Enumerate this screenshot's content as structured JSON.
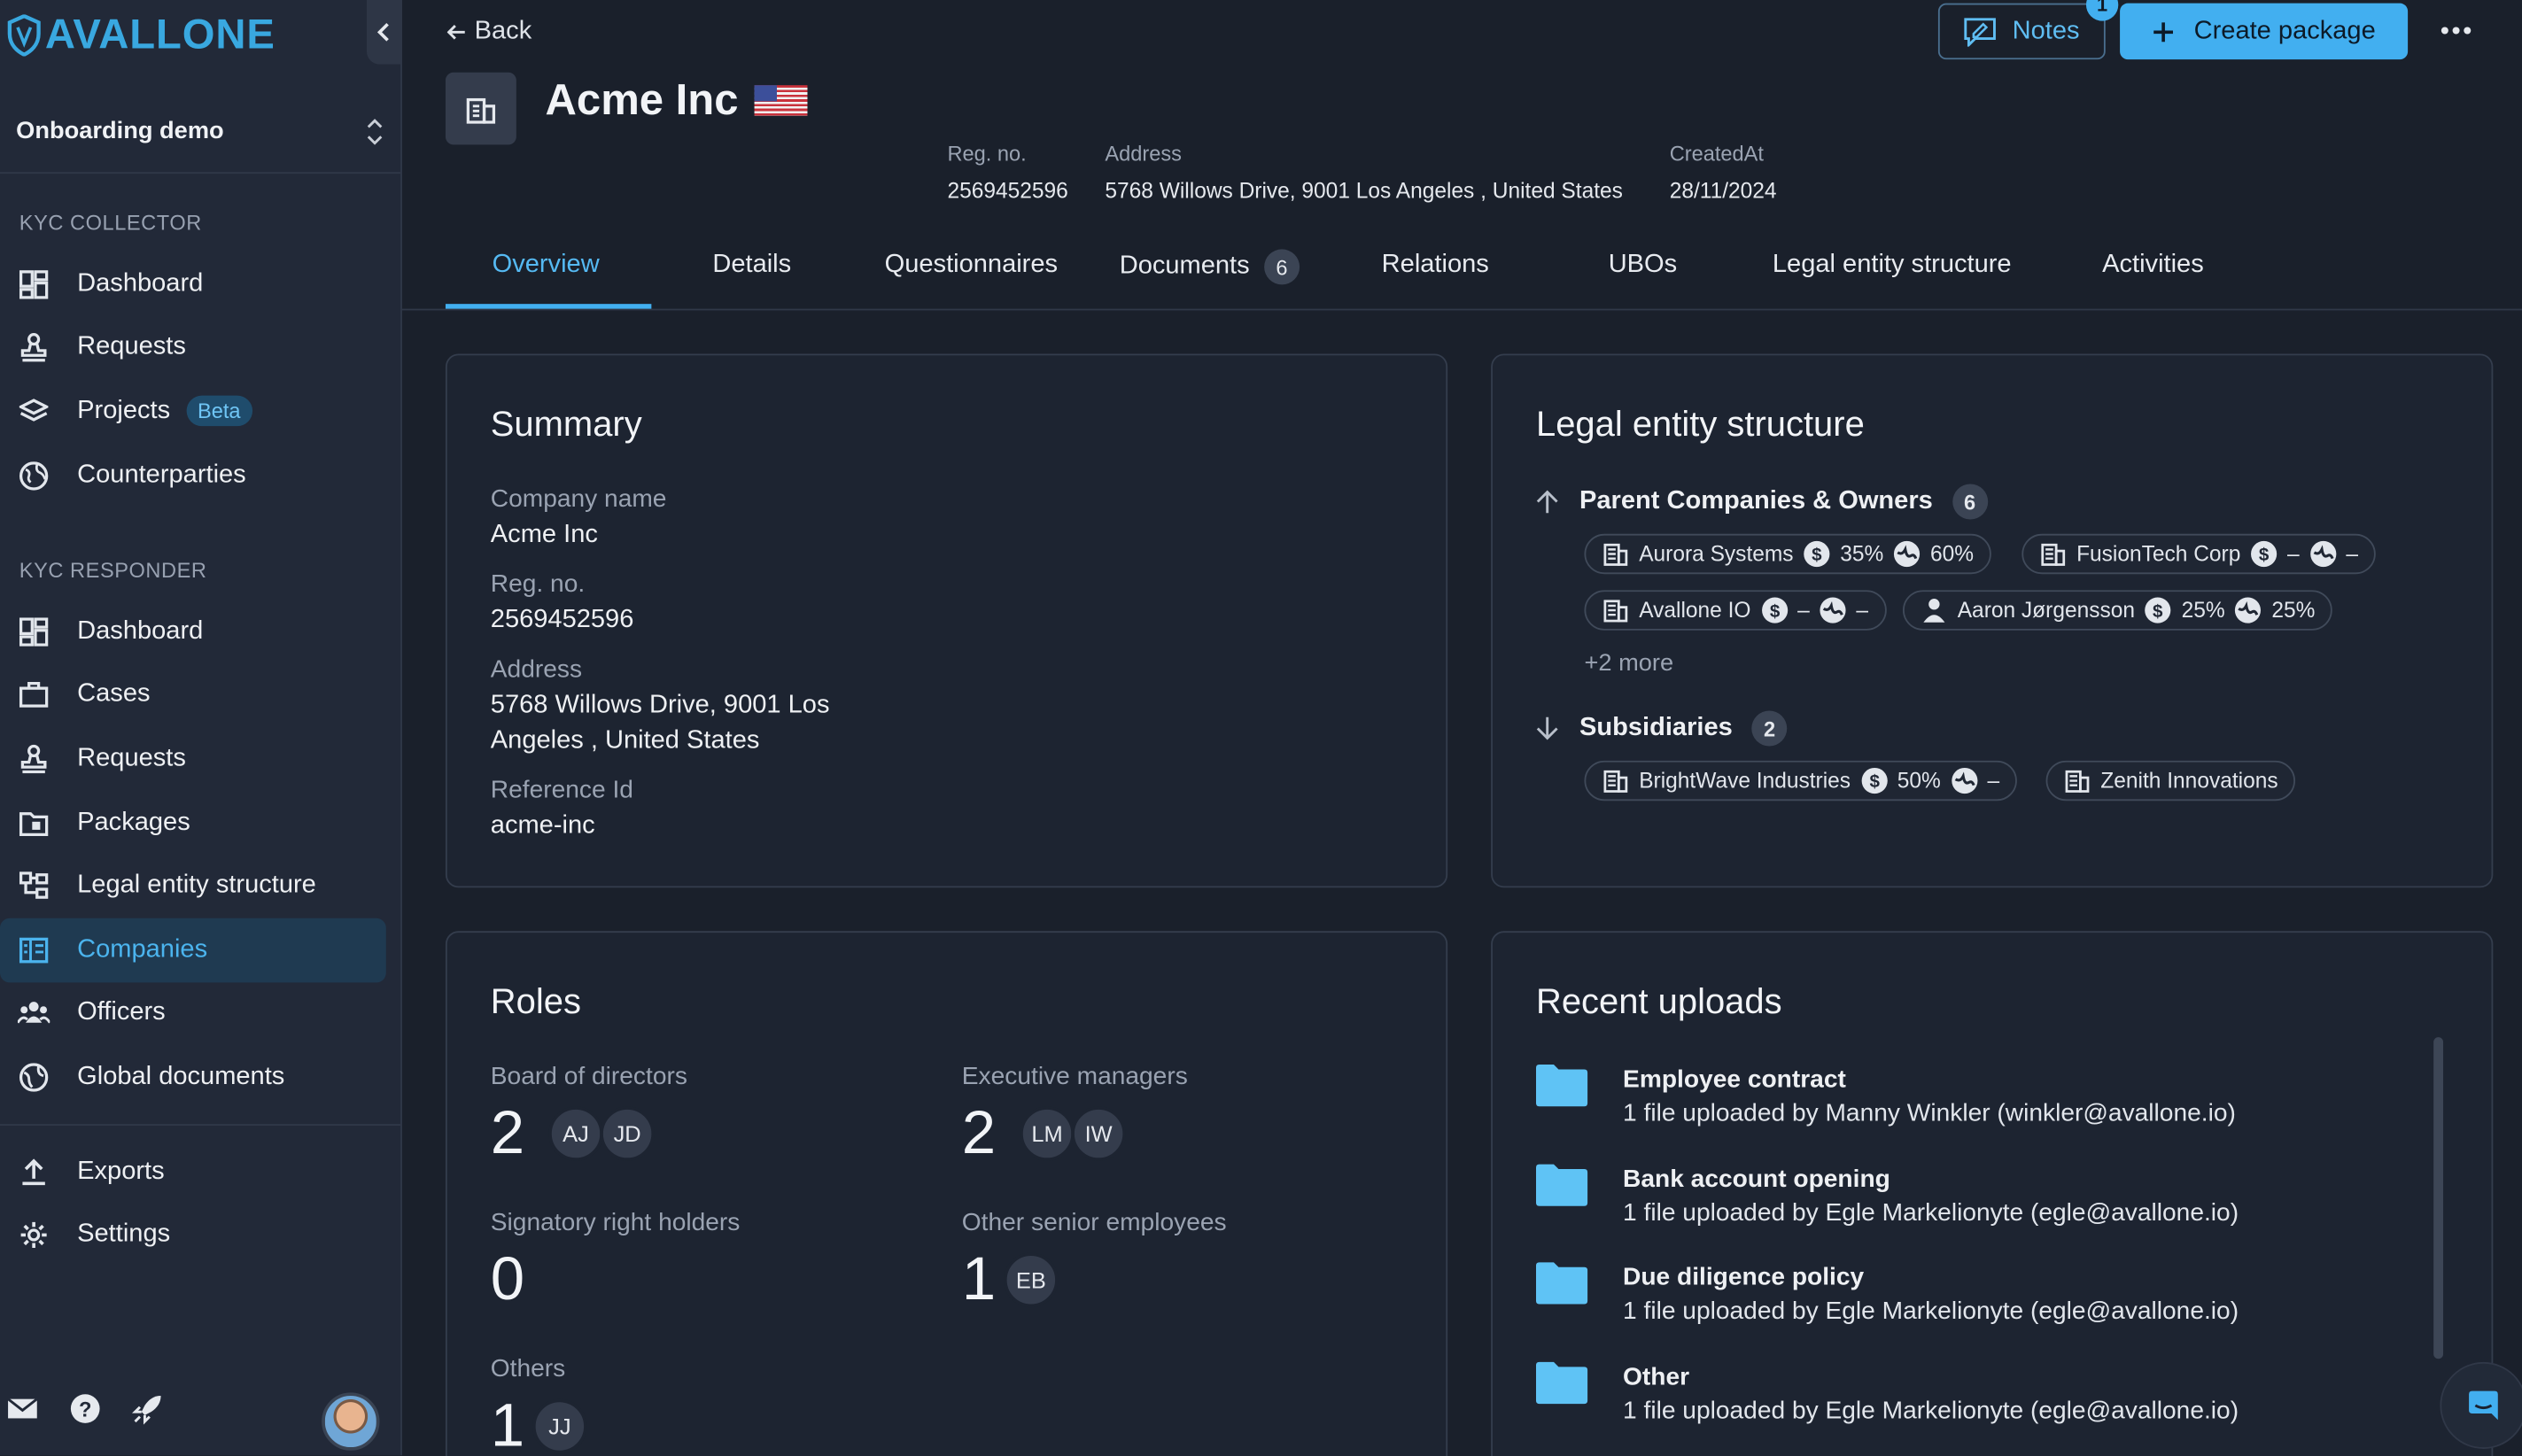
{
  "brand": {
    "logo_text": "AVALLONE",
    "accent": "#42aff0"
  },
  "org_selector": {
    "label": "Onboarding demo"
  },
  "sidebar": {
    "collector_title": "KYC COLLECTOR",
    "collector_items": [
      {
        "label": "Dashboard",
        "icon": "dashboard-icon"
      },
      {
        "label": "Requests",
        "icon": "stamp-icon"
      },
      {
        "label": "Projects",
        "icon": "layers-icon",
        "badge": "Beta"
      },
      {
        "label": "Counterparties",
        "icon": "globe-icon"
      }
    ],
    "responder_title": "KYC RESPONDER",
    "responder_items": [
      {
        "label": "Dashboard",
        "icon": "dashboard-icon"
      },
      {
        "label": "Cases",
        "icon": "briefcase-icon"
      },
      {
        "label": "Requests",
        "icon": "stamp-icon"
      },
      {
        "label": "Packages",
        "icon": "package-icon"
      },
      {
        "label": "Legal entity structure",
        "icon": "hierarchy-icon"
      },
      {
        "label": "Companies",
        "icon": "companies-icon",
        "active": true
      },
      {
        "label": "Officers",
        "icon": "people-icon"
      },
      {
        "label": "Global documents",
        "icon": "world-icon"
      }
    ],
    "bottom_items": [
      {
        "label": "Exports",
        "icon": "upload-icon"
      },
      {
        "label": "Settings",
        "icon": "gear-icon"
      }
    ]
  },
  "header": {
    "back_label": "Back",
    "notes_label": "Notes",
    "notes_count": "1",
    "create_label": "Create package",
    "company_name": "Acme Inc",
    "meta": [
      {
        "key": "Reg. no.",
        "value": "2569452596"
      },
      {
        "key": "Address",
        "value": "5768 Willows Drive, 9001 Los Angeles , United States"
      },
      {
        "key": "CreatedAt",
        "value": "28/11/2024"
      }
    ]
  },
  "tabs": [
    {
      "label": "Overview",
      "active": true
    },
    {
      "label": "Details"
    },
    {
      "label": "Questionnaires"
    },
    {
      "label": "Documents",
      "count": "6"
    },
    {
      "label": "Relations"
    },
    {
      "label": "UBOs"
    },
    {
      "label": "Legal entity structure"
    },
    {
      "label": "Activities"
    }
  ],
  "summary": {
    "title": "Summary",
    "fields": [
      {
        "key": "Company name",
        "value": "Acme Inc"
      },
      {
        "key": "Reg. no.",
        "value": "2569452596"
      },
      {
        "key": "Address",
        "value": "5768 Willows Drive, 9001 Los Angeles , United States"
      },
      {
        "key": "Reference Id",
        "value": "acme-inc"
      }
    ]
  },
  "legal_structure": {
    "title": "Legal entity structure",
    "parents_label": "Parent Companies & Owners",
    "parents_count": "6",
    "parents": [
      {
        "name": "Aurora Systems",
        "share": "35%",
        "vote": "60%"
      },
      {
        "name": "FusionTech Corp",
        "share": "–",
        "vote": "–"
      },
      {
        "name": "Avallone IO",
        "share": "–",
        "vote": "–"
      },
      {
        "name": "Aaron Jørgensson",
        "share": "25%",
        "vote": "25%",
        "person": true
      }
    ],
    "more_label": "+2 more",
    "subs_label": "Subsidiaries",
    "subs_count": "2",
    "subsidiaries": [
      {
        "name": "BrightWave Industries",
        "share": "50%",
        "vote": "–"
      },
      {
        "name": "Zenith Innovations"
      }
    ]
  },
  "roles": {
    "title": "Roles",
    "groups": [
      {
        "label": "Board of directors",
        "count": "2",
        "initials": [
          "AJ",
          "JD"
        ]
      },
      {
        "label": "Executive managers",
        "count": "2",
        "initials": [
          "LM",
          "IW"
        ]
      },
      {
        "label": "Signatory right holders",
        "count": "0",
        "initials": []
      },
      {
        "label": "Other senior employees",
        "count": "1",
        "initials": [
          "EB"
        ]
      },
      {
        "label": "Others",
        "count": "1",
        "initials": [
          "JJ"
        ]
      }
    ]
  },
  "uploads": {
    "title": "Recent uploads",
    "items": [
      {
        "title": "Employee contract",
        "sub": "1 file uploaded by Manny Winkler (winkler@avallone.io)"
      },
      {
        "title": "Bank account opening",
        "sub": "1 file uploaded by Egle Markelionyte (egle@avallone.io)"
      },
      {
        "title": "Due diligence policy",
        "sub": "1 file uploaded by Egle Markelionyte (egle@avallone.io)"
      },
      {
        "title": "Other",
        "sub": "1 file uploaded by Egle Markelionyte (egle@avallone.io)"
      }
    ]
  }
}
